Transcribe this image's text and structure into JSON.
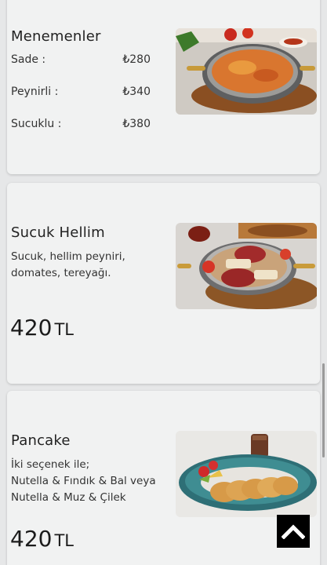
{
  "menu": {
    "menemenler": {
      "title": "Menemenler",
      "rows": [
        {
          "label": "Sade :",
          "price": "₺280"
        },
        {
          "label": "Peynirli :",
          "price": "₺340"
        },
        {
          "label": "Sucuklu :",
          "price": "₺380"
        }
      ]
    },
    "sucuk_hellim": {
      "title": "Sucuk Hellim",
      "desc_line1": "Sucuk, hellim peyniri,",
      "desc_line2": "domates, tereyağı.",
      "price": "420",
      "currency": "TL"
    },
    "pancake": {
      "title": "Pancake",
      "desc_line1": "İki seçenek ile;",
      "desc_line2": "Nutella & Fındık & Bal veya",
      "desc_line3": "Nutella & Muz & Çilek",
      "price": "420",
      "currency": "TL"
    }
  },
  "scroll_top": {
    "icon": "chevron-up-icon"
  }
}
